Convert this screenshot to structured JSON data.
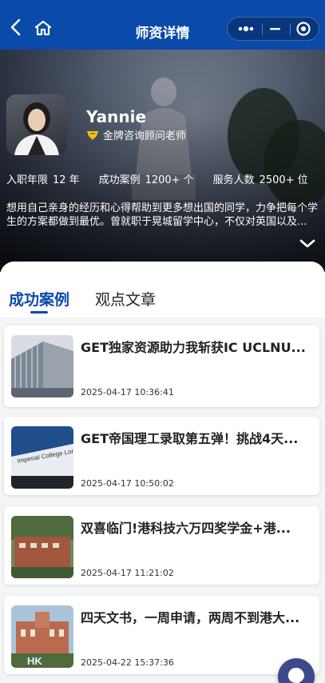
{
  "navbar": {
    "title": "师资详情"
  },
  "profile": {
    "name": "Yannie",
    "role": "金牌咨询顾问老师",
    "stats": [
      {
        "label": "入职年限",
        "value": "12",
        "unit": "年"
      },
      {
        "label": "成功案例",
        "value": "1200+",
        "unit": "个"
      },
      {
        "label": "服务人数",
        "value": "2500+",
        "unit": "位"
      }
    ],
    "bio": "想用自己亲身的经历和心得帮助到更多想出国的同学，力争把每个学生的方案都做到最优。曾就职于晃城留学中心，不仅对英国以及..."
  },
  "tabs": [
    {
      "label": "成功案例",
      "active": true
    },
    {
      "label": "观点文章",
      "active": false
    }
  ],
  "cases": [
    {
      "title": "GET独家资源助力我斩获IC UCLNU...",
      "date": "2025-04-17 10:36:41"
    },
    {
      "title": "GET帝国理工录取第五弹！挑战4天...",
      "date": "2025-04-17 10:50:02"
    },
    {
      "title": "双喜临门!港科技六万四奖学金+港...",
      "date": "2025-04-17 11:21:02"
    },
    {
      "title": "四天文书，一周申请，两周不到港大...",
      "date": "2025-04-22 15:37:36"
    }
  ],
  "thumb_texts": {
    "imperial": "Imperial College London",
    "hk": "HK"
  },
  "colors": {
    "brand": "#0a4aa8",
    "fab": "#3d4a8a"
  },
  "icons": {
    "back": "chevron-left-icon",
    "home": "home-icon",
    "more": "more-dots-icon",
    "minimize": "minus-icon",
    "close": "target-circle-icon",
    "expand": "chevron-down-icon",
    "badge": "badge-icon",
    "fab": "chat-icon"
  }
}
